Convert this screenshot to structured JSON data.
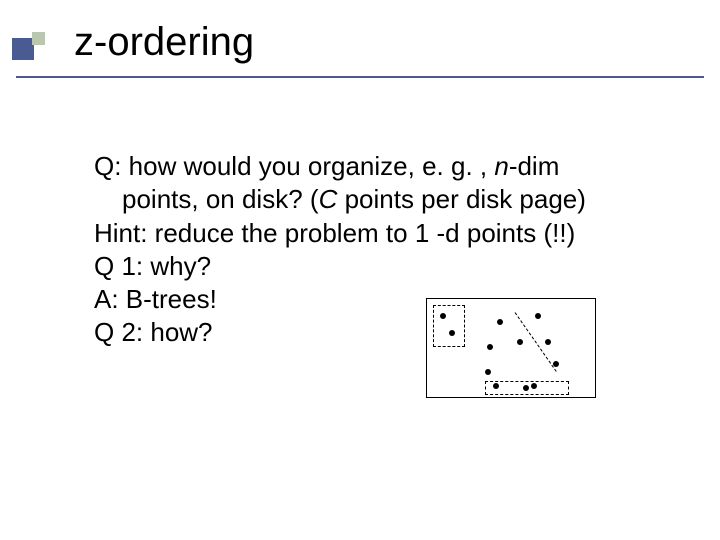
{
  "title": "z-ordering",
  "body": {
    "l1a": "Q: how would you organize, e. g. , ",
    "l1b": "n",
    "l1c": "-dim",
    "l2a": "points, on disk? (",
    "l2b": "C ",
    "l2c": "points per disk page)",
    "l3": "Hint: reduce the problem to 1 -d points (!!)",
    "l4": "Q 1: why?",
    "l5": "A: B-trees!",
    "l6": "Q 2: how?"
  }
}
